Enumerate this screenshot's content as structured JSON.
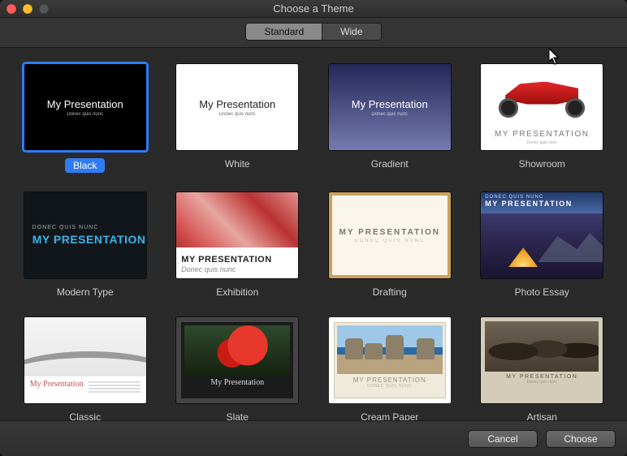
{
  "window": {
    "title": "Choose a Theme"
  },
  "segments": {
    "standard": "Standard",
    "wide": "Wide",
    "active": "standard"
  },
  "presentation": {
    "title": "My Presentation",
    "subtitle": "Donec quis nunc"
  },
  "presentation_upper": {
    "title": "MY PRESENTATION",
    "subtitle": "Donec quis nunc",
    "tiny": "DONEC QUIS NUNC"
  },
  "themes": {
    "black": {
      "label": "Black",
      "selected": true
    },
    "white": {
      "label": "White"
    },
    "gradient": {
      "label": "Gradient"
    },
    "showroom": {
      "label": "Showroom"
    },
    "modern": {
      "label": "Modern Type"
    },
    "exhibition": {
      "label": "Exhibition"
    },
    "drafting": {
      "label": "Drafting"
    },
    "photo": {
      "label": "Photo Essay"
    },
    "classic": {
      "label": "Classic"
    },
    "slate": {
      "label": "Slate"
    },
    "cream": {
      "label": "Cream Paper"
    },
    "artisan": {
      "label": "Artisan"
    }
  },
  "footer": {
    "cancel": "Cancel",
    "choose": "Choose"
  }
}
